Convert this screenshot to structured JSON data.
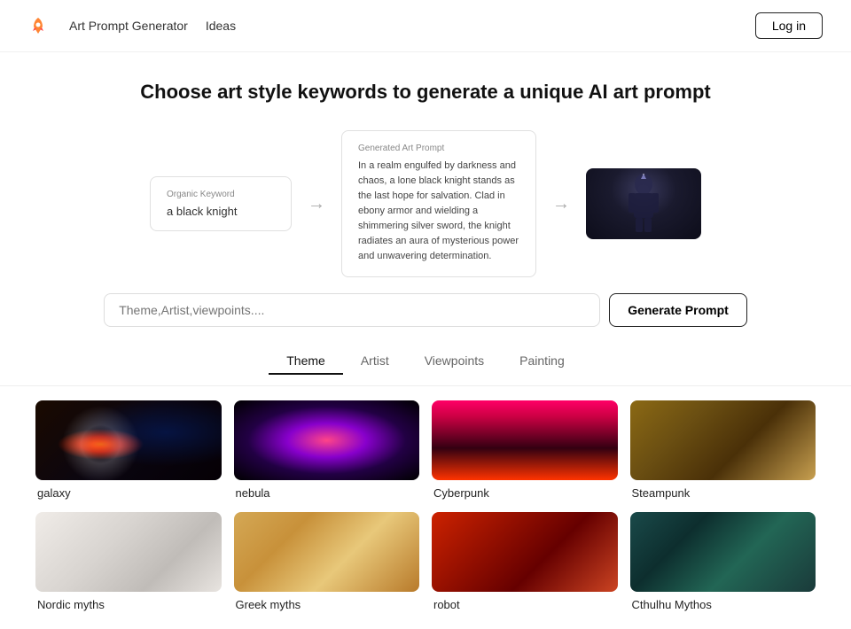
{
  "nav": {
    "logo_alt": "rocket-logo",
    "links": [
      "Art Prompt Generator",
      "Ideas"
    ],
    "login_label": "Log in"
  },
  "hero": {
    "title": "Choose art style keywords to generate a unique AI art prompt"
  },
  "preview": {
    "organic_label": "Organic Keyword",
    "organic_value": "a black knight",
    "generated_label": "Generated Art Prompt",
    "generated_text": "In a realm engulfed by darkness and chaos, a lone black knight stands as the last hope for salvation. Clad in ebony armor and wielding a shimmering silver sword, the knight radiates an aura of mysterious power and unwavering determination.",
    "arrow1": "→",
    "arrow2": "→"
  },
  "search": {
    "placeholder": "Theme,Artist,viewpoints....",
    "button_label": "Generate Prompt"
  },
  "tabs": [
    {
      "label": "Theme",
      "active": true
    },
    {
      "label": "Artist",
      "active": false
    },
    {
      "label": "Viewpoints",
      "active": false
    },
    {
      "label": "Painting",
      "active": false
    }
  ],
  "grid": {
    "row1": [
      {
        "label": "galaxy",
        "img_class": "img-galaxy"
      },
      {
        "label": "nebula",
        "img_class": "img-nebula"
      },
      {
        "label": "Cyberpunk",
        "img_class": "img-cyberpunk"
      },
      {
        "label": "Steampunk",
        "img_class": "img-steampunk"
      }
    ],
    "row2": [
      {
        "label": "Nordic myths",
        "img_class": "img-nordic"
      },
      {
        "label": "Greek myths",
        "img_class": "img-greek"
      },
      {
        "label": "robot",
        "img_class": "img-robot"
      },
      {
        "label": "Cthulhu Mythos",
        "img_class": "img-cthulhu"
      }
    ]
  }
}
